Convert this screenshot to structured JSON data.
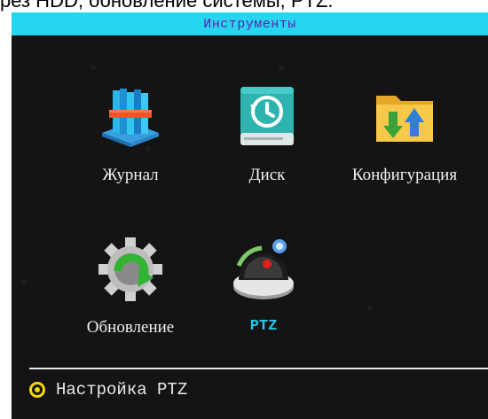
{
  "caption": "рез HDD, обновление системы, PTZ.",
  "window": {
    "title": "Инструменты"
  },
  "tools": [
    {
      "label": "Журнал",
      "icon": "journal-books-icon",
      "selected": false
    },
    {
      "label": "Диск",
      "icon": "disk-history-icon",
      "selected": false
    },
    {
      "label": "Конфигурация",
      "icon": "config-folder-icon",
      "selected": false
    },
    {
      "label": "Обновление",
      "icon": "update-gear-icon",
      "selected": false
    },
    {
      "label": "PTZ",
      "icon": "ptz-camera-icon",
      "selected": true
    }
  ],
  "status": {
    "text": "Настройка PTZ",
    "bullet_icon": "yellow-circle-bullet-icon"
  },
  "colors": {
    "title_bar": "#27d6ee",
    "title_text": "#5b1fb0",
    "background": "#141414",
    "selected_label": "#22c8e6",
    "bullet": "#f5d800"
  }
}
